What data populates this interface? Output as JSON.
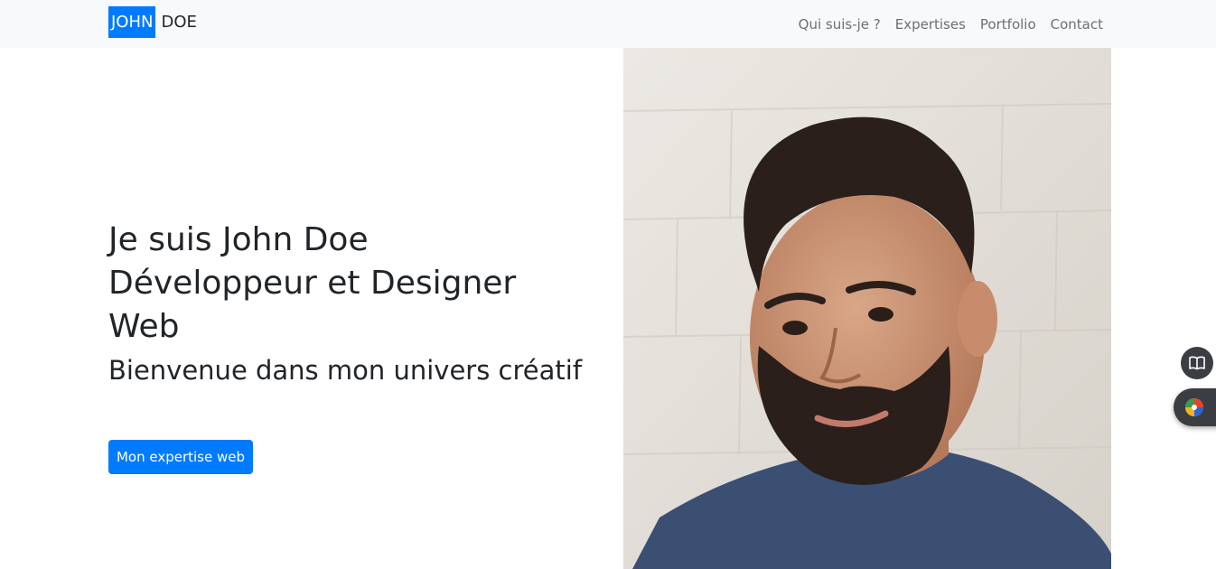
{
  "navbar": {
    "brand_first": "JOHN",
    "brand_last": "DOE",
    "links": [
      {
        "label": "Qui suis-je ?"
      },
      {
        "label": "Expertises"
      },
      {
        "label": "Portfolio"
      },
      {
        "label": "Contact"
      }
    ]
  },
  "hero": {
    "title_line1": "Je suis John Doe",
    "title_line2": "Développeur et Designer",
    "title_line3": "Web",
    "subtitle": "Bienvenue dans mon univers créatif",
    "cta_label": "Mon expertise web"
  },
  "colors": {
    "accent": "#007bff",
    "navbar_bg": "#f8f9fa",
    "text": "#212529",
    "nav_link": "#6c6f73"
  },
  "icons": {
    "reader": "book-icon",
    "extension": "color-wheel-icon"
  }
}
